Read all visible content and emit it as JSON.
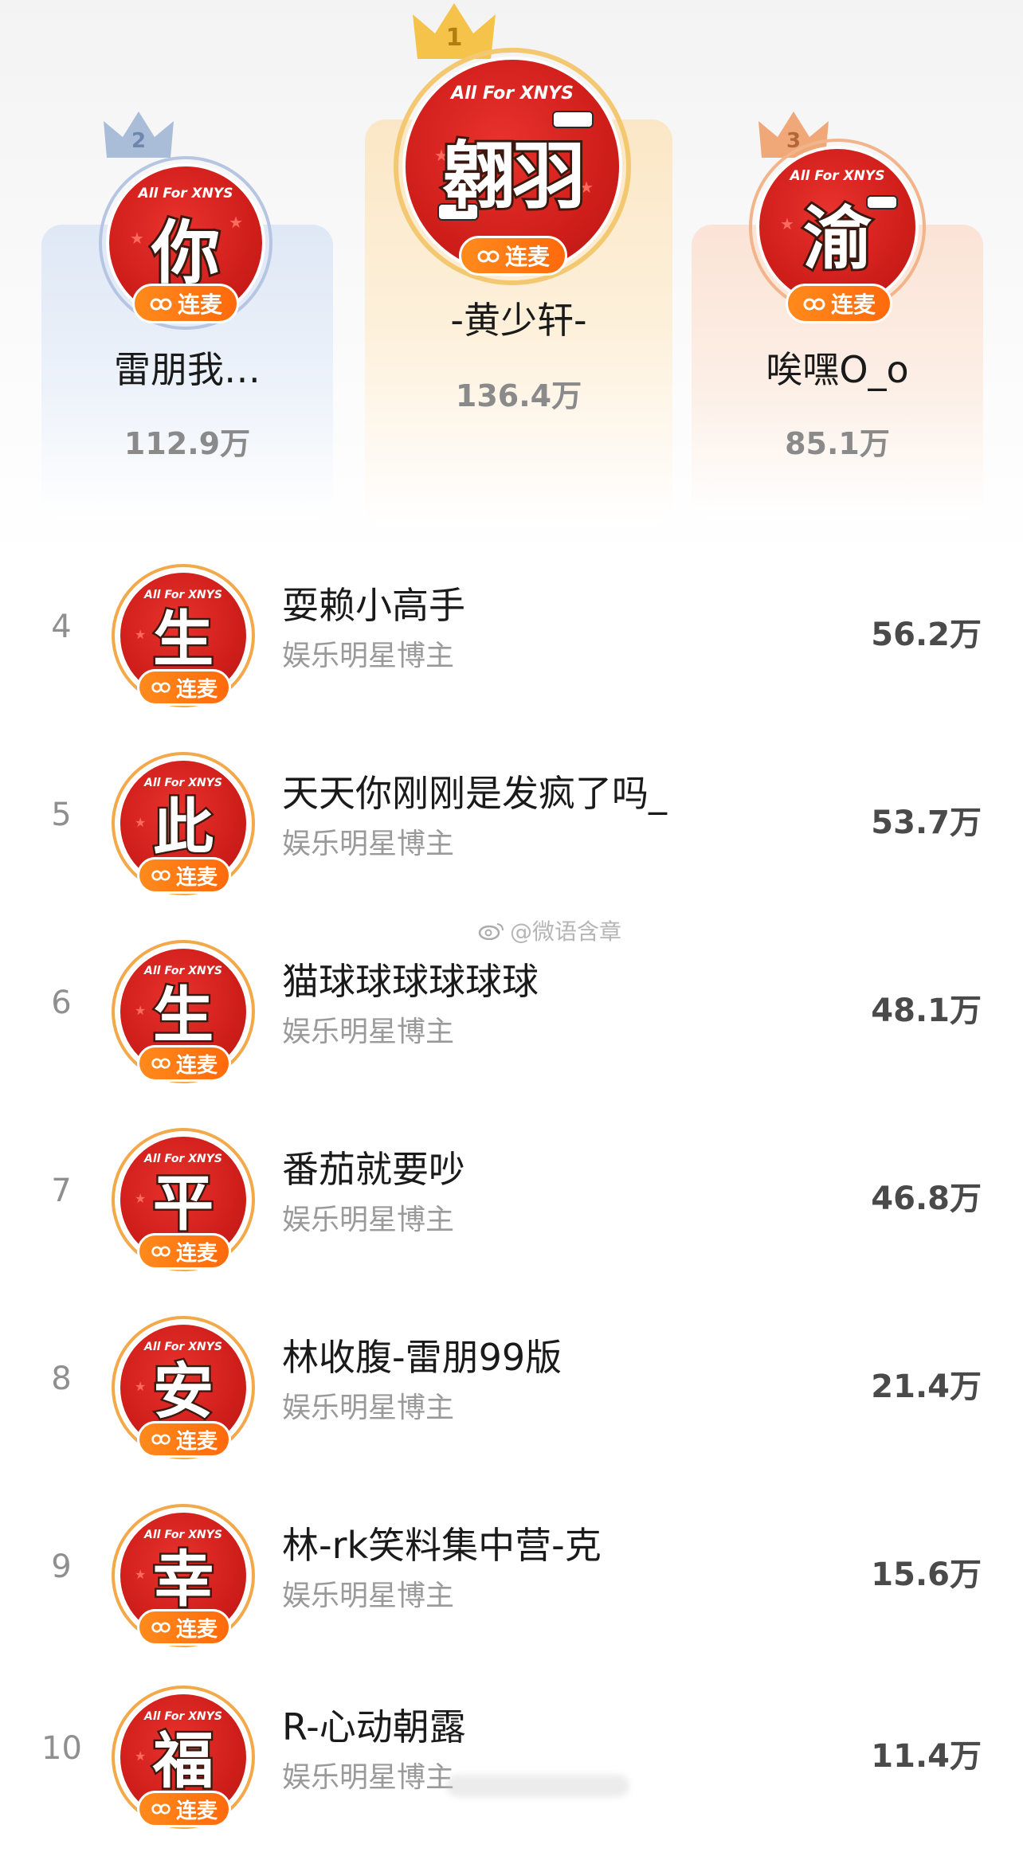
{
  "podium": [
    {
      "rank": "1",
      "avatar_char": "翱羽",
      "ring_text": "All For XNYS",
      "badge": "连麦",
      "name": "-黄少轩-",
      "score": "136.4万",
      "crown_color": "#f5c24a"
    },
    {
      "rank": "2",
      "avatar_char": "你",
      "ring_text": "All For XNYS",
      "badge": "连麦",
      "name": "雷朋我…",
      "score": "112.9万",
      "crown_color": "#a9bcd8"
    },
    {
      "rank": "3",
      "avatar_char": "渝",
      "ring_text": "All For XNYS",
      "badge": "连麦",
      "name": "唉嘿O_o",
      "score": "85.1万",
      "crown_color": "#f0a878"
    }
  ],
  "list": [
    {
      "rank": "4",
      "avatar_char": "生",
      "name": "耍赖小高手",
      "subtitle": "娱乐明星博主",
      "score": "56.2万",
      "badge": "连麦",
      "ring_text": "All For XNYS"
    },
    {
      "rank": "5",
      "avatar_char": "此",
      "name": "天天你刚刚是发疯了吗_",
      "subtitle": "娱乐明星博主",
      "score": "53.7万",
      "badge": "连麦",
      "ring_text": "All For XNYS"
    },
    {
      "rank": "6",
      "avatar_char": "生",
      "name": "猫球球球球球球",
      "subtitle": "娱乐明星博主",
      "score": "48.1万",
      "badge": "连麦",
      "ring_text": "All For XNYS"
    },
    {
      "rank": "7",
      "avatar_char": "平",
      "name": "番茄就要吵",
      "subtitle": "娱乐明星博主",
      "score": "46.8万",
      "badge": "连麦",
      "ring_text": "All For XNYS"
    },
    {
      "rank": "8",
      "avatar_char": "安",
      "name": "林收腹-雷朋99版",
      "subtitle": "娱乐明星博主",
      "score": "21.4万",
      "badge": "连麦",
      "ring_text": "All For XNYS"
    },
    {
      "rank": "9",
      "avatar_char": "幸",
      "name": "林-rk笑料集中营-克",
      "subtitle": "娱乐明星博主",
      "score": "15.6万",
      "badge": "连麦",
      "ring_text": "All For XNYS"
    },
    {
      "rank": "10",
      "avatar_char": "福",
      "name": "R-心动朝露",
      "subtitle": "娱乐明星博主",
      "score": "11.4万",
      "badge": "连麦",
      "ring_text": "All For XNYS"
    }
  ],
  "watermark": "@微语含章",
  "colors": {
    "avatar_red": "#d2201c",
    "badge_orange": "#ff7a14",
    "gold": "#f5c24a",
    "silver": "#a9bcd8",
    "bronze": "#f0a878"
  }
}
